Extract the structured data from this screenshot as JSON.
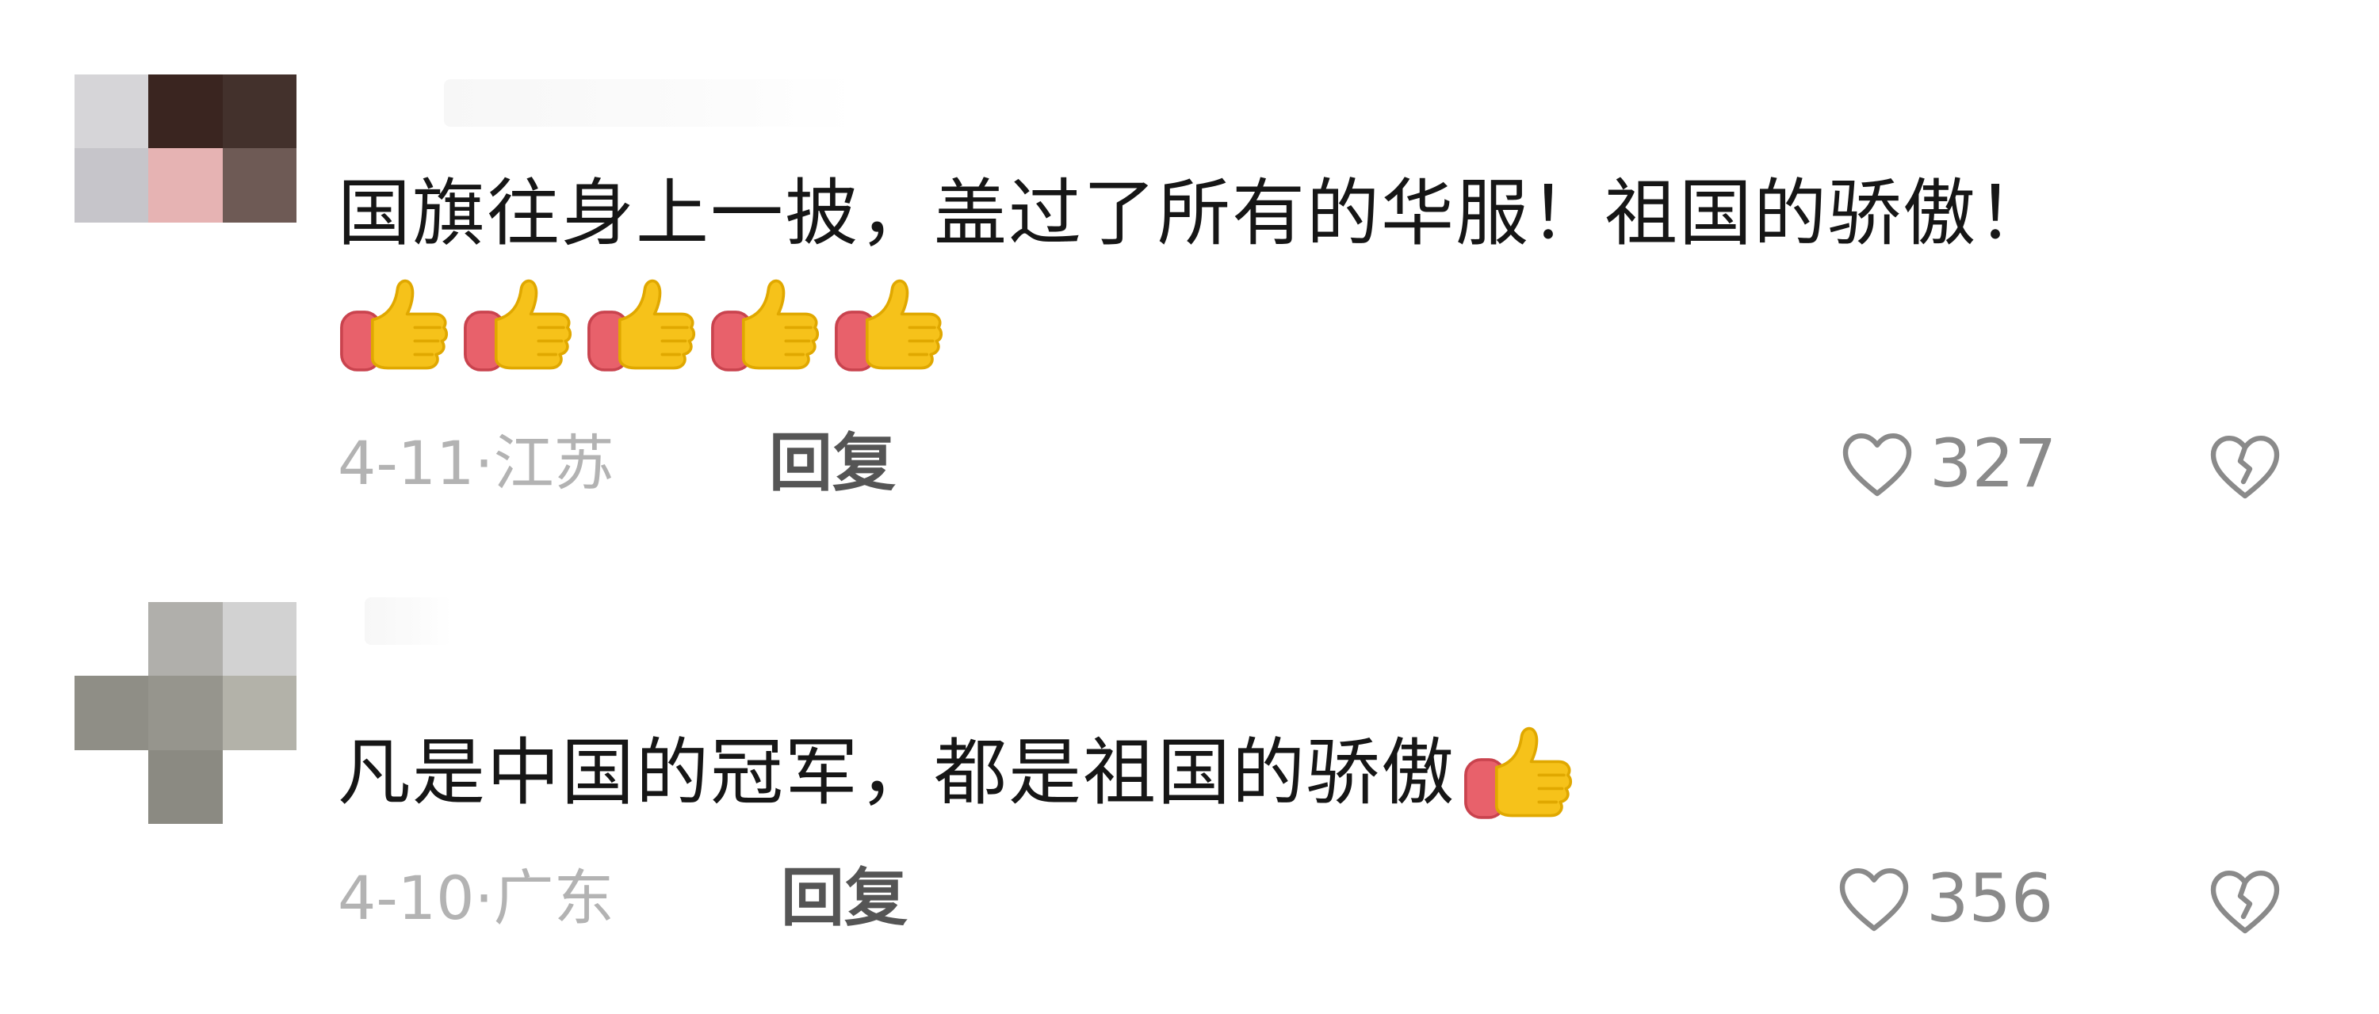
{
  "comments": [
    {
      "text": "国旗往身上一披，盖过了所有的华服！祖国的骄傲！",
      "emoji_count": 5,
      "emoji_icon": "thumbs-up-icon",
      "meta": "4-11·江苏",
      "reply_label": "回复",
      "likes": "327",
      "like_icon": "heart-outline-icon",
      "dislike_icon": "broken-heart-icon"
    },
    {
      "text": "凡是中国的冠军，都是祖国的骄傲",
      "emoji_count": 1,
      "emoji_icon": "thumbs-up-icon",
      "meta": "4-10·广东",
      "reply_label": "回复",
      "likes": "356",
      "like_icon": "heart-outline-icon",
      "dislike_icon": "broken-heart-icon"
    }
  ],
  "colors": {
    "text": "#161616",
    "meta": "#b3b3b3",
    "reply": "#555555",
    "icon": "#8a8a8a"
  }
}
